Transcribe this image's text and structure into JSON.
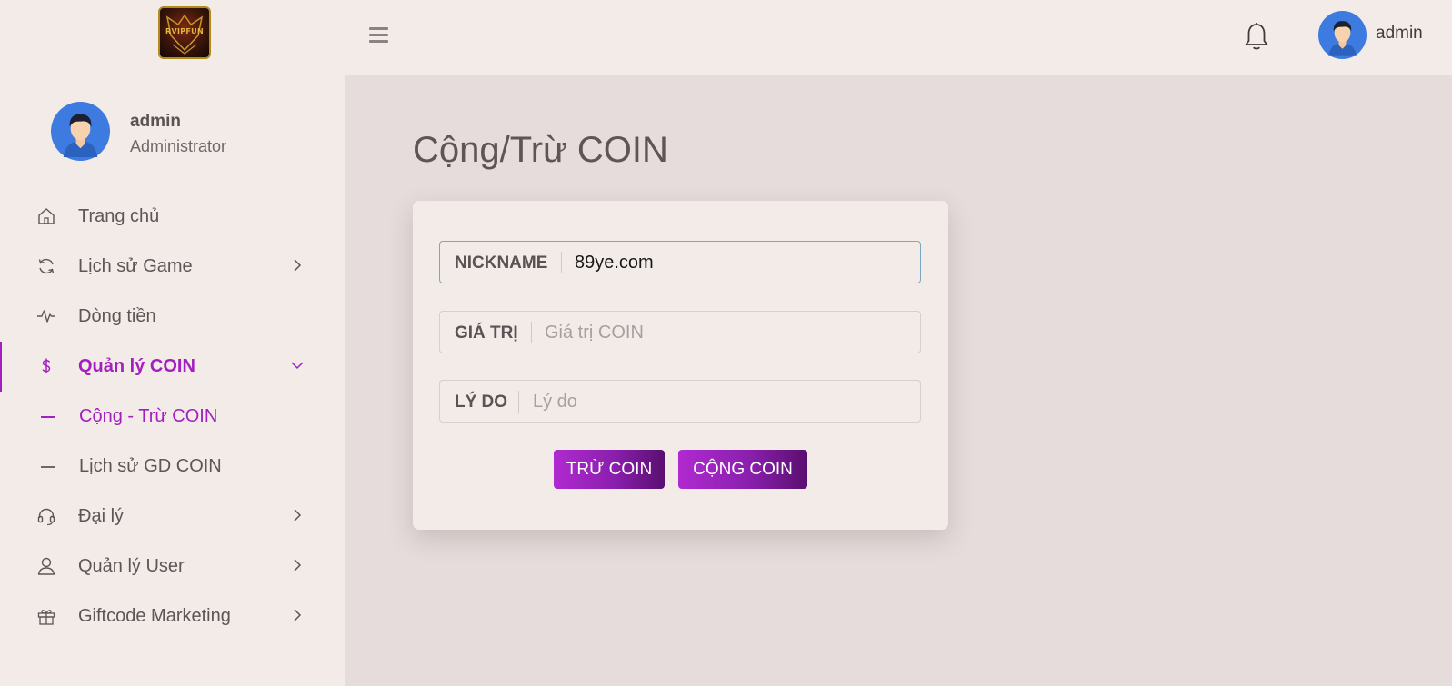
{
  "header": {
    "logo_text": "RVIPFUN",
    "menu_icon": "hamburger-icon",
    "notification_icon": "bell-icon",
    "user_name": "admin"
  },
  "sidebar": {
    "profile": {
      "name": "admin",
      "role": "Administrator"
    },
    "items": [
      {
        "label": "Trang chủ",
        "icon": "home-icon"
      },
      {
        "label": "Lịch sử Game",
        "icon": "refresh-icon",
        "expandable": true
      },
      {
        "label": "Dòng tiền",
        "icon": "pulse-icon"
      },
      {
        "label": "Quản lý COIN",
        "icon": "dollar-icon",
        "expandable": true,
        "expanded": true,
        "active": true
      },
      {
        "label": "Đại lý",
        "icon": "headset-icon",
        "expandable": true
      },
      {
        "label": "Quản lý User",
        "icon": "user-icon",
        "expandable": true
      },
      {
        "label": "Giftcode Marketing",
        "icon": "gift-icon",
        "expandable": true
      }
    ],
    "subitems": [
      {
        "label": "Cộng - Trừ COIN",
        "active": true
      },
      {
        "label": "Lịch sử GD COIN"
      }
    ]
  },
  "main": {
    "title": "Cộng/Trừ COIN",
    "form": {
      "nickname": {
        "label": "NICKNAME",
        "value": "89ye.com",
        "placeholder": ""
      },
      "amount": {
        "label": "GIÁ TRỊ",
        "value": "",
        "placeholder": "Giá trị COIN"
      },
      "reason": {
        "label": "LÝ DO",
        "value": "",
        "placeholder": "Lý do"
      }
    },
    "buttons": {
      "subtract": "TRỪ COIN",
      "add": "CỘNG COIN"
    }
  },
  "colors": {
    "accent": "#a41fc0",
    "sidebar_bg": "#f2ebe8",
    "content_bg": "#e5dcdb",
    "button_gradient": [
      "#b02ad0",
      "#5a0f70"
    ]
  }
}
